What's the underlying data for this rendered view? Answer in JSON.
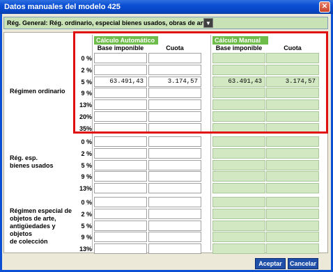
{
  "window": {
    "title": "Datos manuales del modelo 425",
    "close_glyph": "✕"
  },
  "regimen_select": {
    "value": "Rég. General: Rég. ordinario, especial bienes usados, obras de arte",
    "arrow": "▼"
  },
  "columns": {
    "auto_tab": "Cálculo Automático",
    "manual_tab": "Cálculo Manual",
    "base": "Base imponible",
    "cuota": "Cuota"
  },
  "sections": [
    {
      "label": "Régimen ordinario",
      "rows": [
        {
          "rate": "0 %",
          "auto_base": "",
          "auto_cuota": "",
          "man_base": "",
          "man_cuota": ""
        },
        {
          "rate": "2 %",
          "auto_base": "",
          "auto_cuota": "",
          "man_base": "",
          "man_cuota": ""
        },
        {
          "rate": "5 %",
          "auto_base": "63.491,43",
          "auto_cuota": "3.174,57",
          "man_base": "63.491,43",
          "man_cuota": "3.174,57"
        },
        {
          "rate": "9 %",
          "auto_base": "",
          "auto_cuota": "",
          "man_base": "",
          "man_cuota": ""
        },
        {
          "rate": "13%",
          "auto_base": "",
          "auto_cuota": "",
          "man_base": "",
          "man_cuota": ""
        },
        {
          "rate": "20%",
          "auto_base": "",
          "auto_cuota": "",
          "man_base": "",
          "man_cuota": ""
        },
        {
          "rate": "35%",
          "auto_base": "",
          "auto_cuota": "",
          "man_base": "",
          "man_cuota": ""
        }
      ]
    },
    {
      "label": "Rég. esp.\nbienes usados",
      "rows": [
        {
          "rate": "0 %"
        },
        {
          "rate": "2 %"
        },
        {
          "rate": "5 %"
        },
        {
          "rate": "9 %"
        },
        {
          "rate": "13%"
        }
      ]
    },
    {
      "label": "Régimen especial de\nobjetos de arte,\nantigüedades y objetos\nde colección",
      "rows": [
        {
          "rate": "0 %"
        },
        {
          "rate": "2 %"
        },
        {
          "rate": "5 %"
        },
        {
          "rate": "9 %"
        },
        {
          "rate": "13%"
        }
      ]
    }
  ],
  "buttons": {
    "accept": "Aceptar",
    "cancel": "Cancelar"
  },
  "colors": {
    "titlebar": "#0a4fd4",
    "manual_cell": "#d2e8c3",
    "tab": "#6ebd4a",
    "highlight": "#e01010"
  }
}
